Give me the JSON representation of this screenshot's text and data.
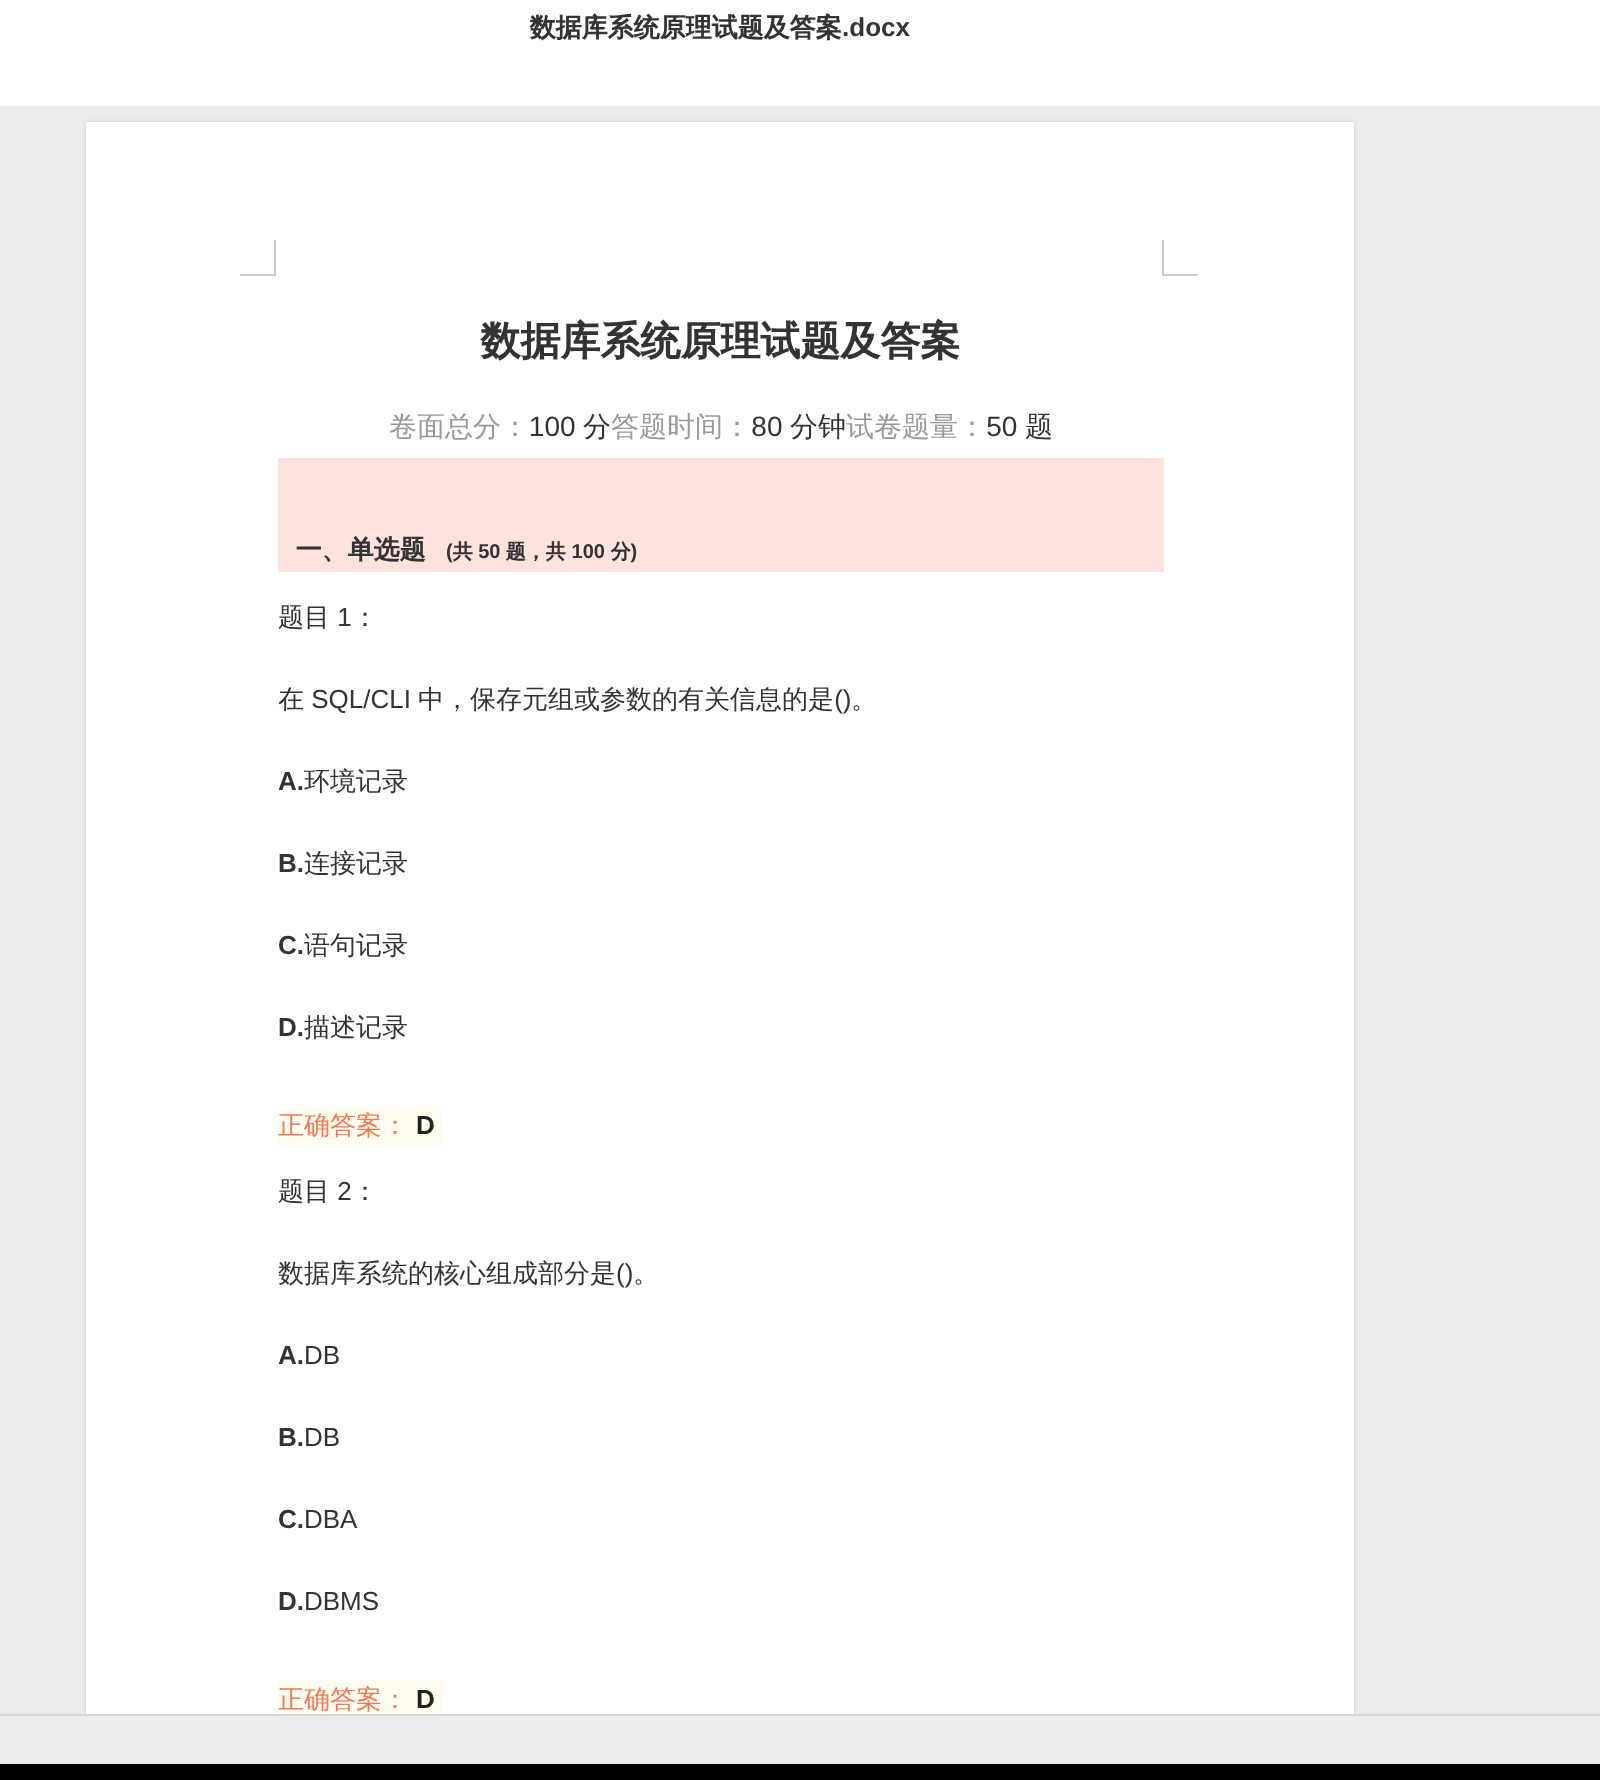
{
  "window": {
    "title": "数据库系统原理试题及答案.docx"
  },
  "document": {
    "title": "数据库系统原理试题及答案",
    "meta": [
      {
        "label": "卷面总分：",
        "value": "100 分"
      },
      {
        "label": "答题时间：",
        "value": "80 分钟"
      },
      {
        "label": "试卷题量：",
        "value": "50 题"
      }
    ],
    "section": {
      "heading": "一、单选题",
      "note": "(共 50 题，共 100 分)"
    },
    "questions": [
      {
        "number": "题目 1：",
        "text": "在 SQL/CLI 中，保存元组或参数的有关信息的是()。",
        "options": [
          {
            "letter": "A.",
            "text": "环境记录"
          },
          {
            "letter": "B.",
            "text": "连接记录"
          },
          {
            "letter": "C.",
            "text": "语句记录"
          },
          {
            "letter": "D.",
            "text": "描述记录"
          }
        ],
        "answer_label": "正确答案：",
        "answer": "D"
      },
      {
        "number": "题目 2：",
        "text": "数据库系统的核心组成部分是()。",
        "options": [
          {
            "letter": "A.",
            "text": "DB"
          },
          {
            "letter": "B.",
            "text": "DB"
          },
          {
            "letter": "C.",
            "text": "DBA"
          },
          {
            "letter": "D.",
            "text": "DBMS"
          }
        ],
        "answer_label": "正确答案：",
        "answer": "D"
      }
    ]
  }
}
